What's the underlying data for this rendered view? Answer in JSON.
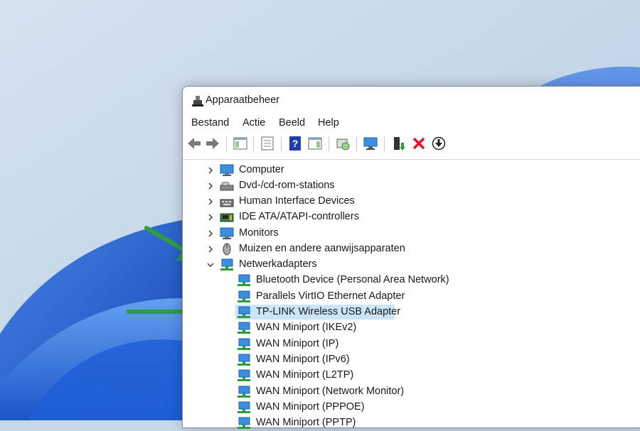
{
  "window": {
    "title": "Apparaatbeheer"
  },
  "menu": {
    "items": [
      "Bestand",
      "Actie",
      "Beeld",
      "Help"
    ]
  },
  "tree": {
    "categories": [
      {
        "label": "Computer",
        "icon": "monitor-icon",
        "expanded": false
      },
      {
        "label": "Dvd-/cd-rom-stations",
        "icon": "disc-drive-icon",
        "expanded": false
      },
      {
        "label": "Human Interface Devices",
        "icon": "hid-icon",
        "expanded": false
      },
      {
        "label": "IDE ATA/ATAPI-controllers",
        "icon": "ide-controller-icon",
        "expanded": false
      },
      {
        "label": "Monitors",
        "icon": "monitor-icon",
        "expanded": false
      },
      {
        "label": "Muizen en andere aanwijsapparaten",
        "icon": "mouse-icon",
        "expanded": false
      },
      {
        "label": "Netwerkadapters",
        "icon": "network-icon",
        "expanded": true
      }
    ],
    "network_children": [
      "Bluetooth Device (Personal Area Network)",
      "Parallels VirtIO Ethernet Adapter",
      "TP-LINK Wireless USB Adapter",
      "WAN Miniport (IKEv2)",
      "WAN Miniport (IP)",
      "WAN Miniport (IPv6)",
      "WAN Miniport (L2TP)",
      "WAN Miniport (Network Monitor)",
      "WAN Miniport (PPPOE)",
      "WAN Miniport (PPTP)"
    ],
    "selected_child": "TP-LINK Wireless USB Adapter"
  },
  "colors": {
    "desktop_bg": "#c9d9ea",
    "selection": "#cce4f7",
    "arrow_green": "#2e9e3a",
    "delete_red": "#e81123"
  }
}
